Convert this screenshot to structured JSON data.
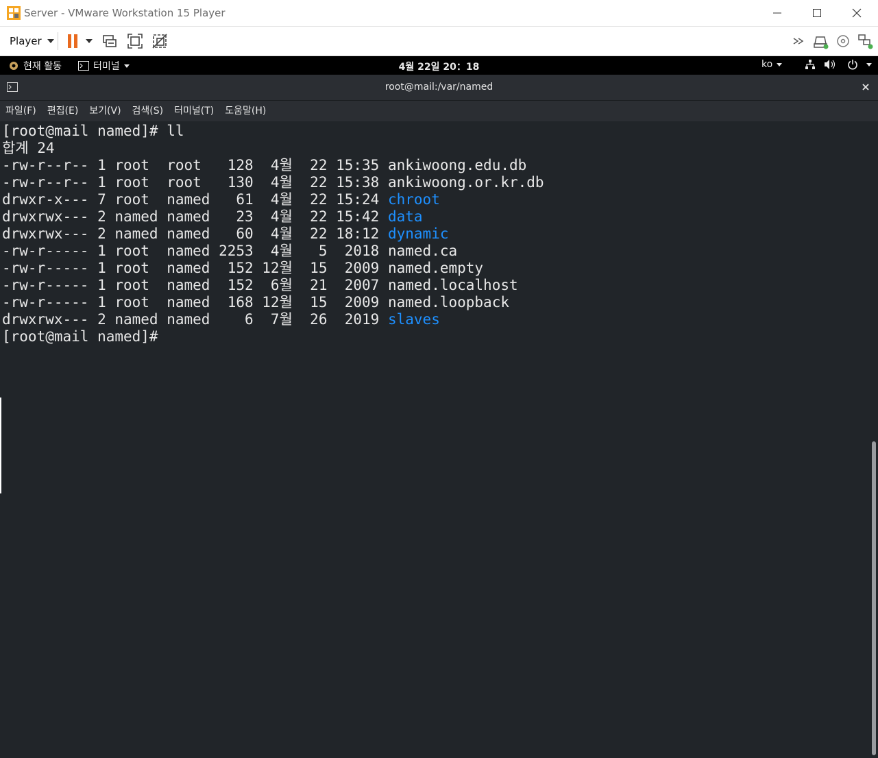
{
  "vmware": {
    "window_title": "Server - VMware Workstation 15 Player",
    "toolbar": {
      "player_menu_label": "Player",
      "icons": [
        "pause-icon",
        "send-ctrl-alt-del-icon",
        "fullscreen-icon",
        "unity-icon",
        "more-icon",
        "hard-disk-icon",
        "cd-dvd-icon",
        "network-adapter-icon"
      ]
    },
    "accent_color": "#e96a1f"
  },
  "gnome_bar": {
    "activities_label": "현재 활동",
    "app_menu_label": "터미널",
    "clock": "4월 22일  20：18",
    "input_method": "ko"
  },
  "terminal": {
    "title": "root@mail:/var/named",
    "menus": [
      "파일(F)",
      "편집(E)",
      "보기(V)",
      "검색(S)",
      "터미널(T)",
      "도움말(H)"
    ],
    "prompt": "[root@mail named]#",
    "command": " ll",
    "total_line": "합계 24",
    "entries": [
      {
        "meta": "-rw-r--r-- 1 root  root   128  4월  22 15:35 ",
        "name": "ankiwoong.edu.db",
        "is_dir": false
      },
      {
        "meta": "-rw-r--r-- 1 root  root   130  4월  22 15:38 ",
        "name": "ankiwoong.or.kr.db",
        "is_dir": false
      },
      {
        "meta": "drwxr-x--- 7 root  named   61  4월  22 15:24 ",
        "name": "chroot",
        "is_dir": true
      },
      {
        "meta": "drwxrwx--- 2 named named   23  4월  22 15:42 ",
        "name": "data",
        "is_dir": true
      },
      {
        "meta": "drwxrwx--- 2 named named   60  4월  22 18:12 ",
        "name": "dynamic",
        "is_dir": true
      },
      {
        "meta": "-rw-r----- 1 root  named 2253  4월   5  2018 ",
        "name": "named.ca",
        "is_dir": false
      },
      {
        "meta": "-rw-r----- 1 root  named  152 12월  15  2009 ",
        "name": "named.empty",
        "is_dir": false
      },
      {
        "meta": "-rw-r----- 1 root  named  152  6월  21  2007 ",
        "name": "named.localhost",
        "is_dir": false
      },
      {
        "meta": "-rw-r----- 1 root  named  168 12월  15  2009 ",
        "name": "named.loopback",
        "is_dir": false
      },
      {
        "meta": "drwxrwx--- 2 named named    6  7월  26  2019 ",
        "name": "slaves",
        "is_dir": true
      }
    ],
    "directory_color": "#1e90ff",
    "text_color": "#e8e8e8",
    "background_color": "#212529"
  }
}
